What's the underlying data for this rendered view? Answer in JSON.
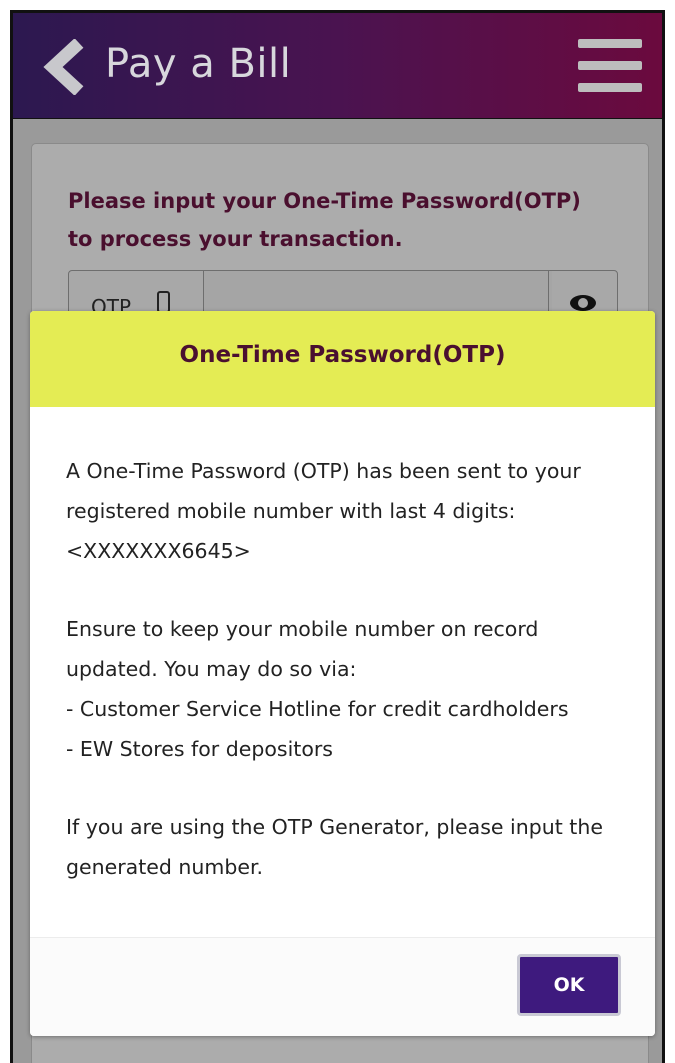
{
  "header": {
    "title": "Pay a Bill",
    "background_colors": [
      "#2c1850",
      "#6b0a3e"
    ]
  },
  "form": {
    "instruction": "Please input your One-Time Password(OTP) to process your transaction.",
    "otp_label": "OTP",
    "otp_value": ""
  },
  "modal": {
    "title": "One-Time Password(OTP)",
    "header_color": "#e4ec54",
    "paragraph1_line1": "A One-Time Password (OTP) has been sent to your registered mobile number with last 4 digits:",
    "paragraph1_line2": "<XXXXXXX6645>",
    "paragraph2_line1": "Ensure to keep your mobile number on record updated. You may do so via:",
    "paragraph2_line2": "- Customer Service Hotline for credit cardholders",
    "paragraph2_line3": "- EW Stores for depositors",
    "paragraph3": "If you are using the OTP Generator, please input the generated number.",
    "ok_label": "OK",
    "ok_color": "#3e1a7e"
  },
  "icons": [
    "chevron-left-icon",
    "hamburger-menu-icon",
    "phone-icon",
    "eye-icon"
  ]
}
